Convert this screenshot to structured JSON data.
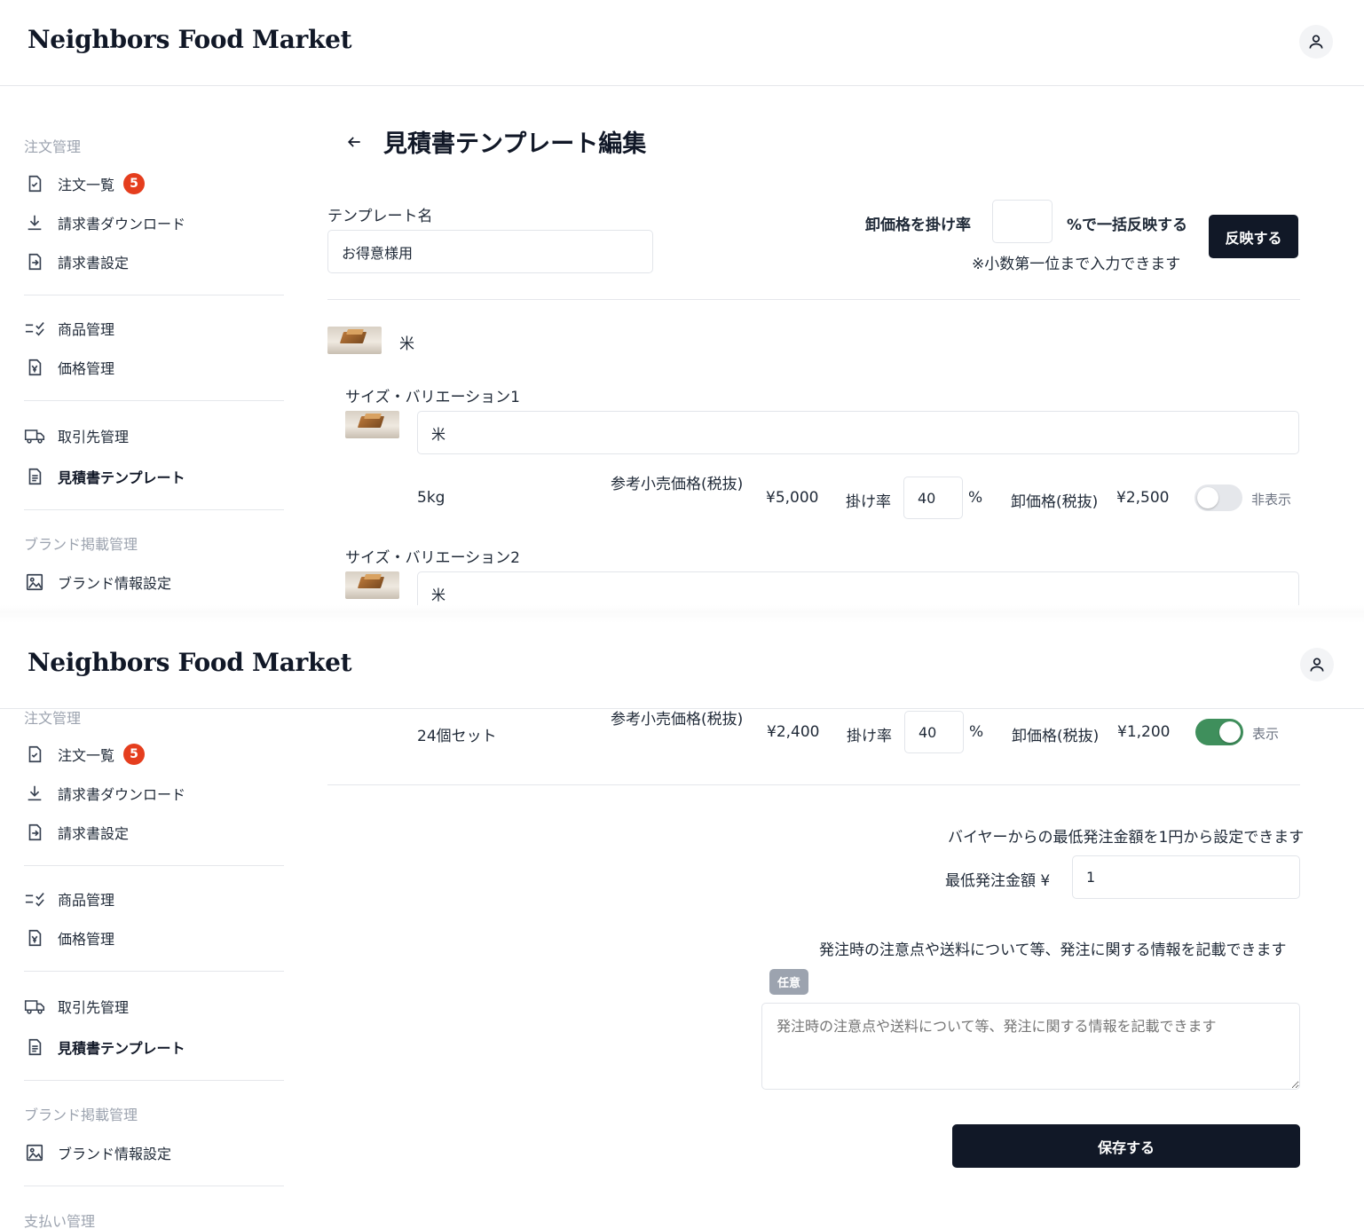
{
  "app": {
    "brand": "Neighbors Food Market"
  },
  "sidebar": {
    "sections": [
      "注文管理",
      "ブランド掲載管理",
      "支払い管理"
    ],
    "items": [
      {
        "label": "注文一覧",
        "icon": "order-list-icon",
        "badge": "5"
      },
      {
        "label": "請求書ダウンロード",
        "icon": "download-icon"
      },
      {
        "label": "請求書設定",
        "icon": "invoice-settings-icon"
      },
      {
        "label": "商品管理",
        "icon": "product-list-icon"
      },
      {
        "label": "価格管理",
        "icon": "price-icon"
      },
      {
        "label": "取引先管理",
        "icon": "truck-icon"
      },
      {
        "label": "見積書テンプレート",
        "icon": "document-icon"
      },
      {
        "label": "ブランド情報設定",
        "icon": "image-icon"
      }
    ]
  },
  "page": {
    "title": "見積書テンプレート編集"
  },
  "form": {
    "template_name_label": "テンプレート名",
    "template_name_value": "お得意様用",
    "bulk_rate_label_pre": "卸価格を掛け率",
    "bulk_rate_value": "",
    "bulk_rate_label_post": "%で一括反映する",
    "bulk_rate_note": "※小数第一位まで入力できます",
    "apply_button": "反映する"
  },
  "product": {
    "name": "米",
    "variations": [
      {
        "label": "サイズ・バリエーション1",
        "name": "米",
        "size": "5kg",
        "retail_label": "参考小売価格(税抜)",
        "retail_price": "¥5,000",
        "rate_label": "掛け率",
        "rate": "40",
        "percent": "%",
        "wholesale_label": "卸価格(税抜)",
        "wholesale_price": "¥2,500",
        "visible": false,
        "visibility_label": "非表示"
      },
      {
        "label": "サイズ・バリエーション2",
        "name": "米"
      },
      {
        "size": "24個セット",
        "retail_label": "参考小売価格(税抜)",
        "retail_price": "¥2,400",
        "rate_label": "掛け率",
        "rate": "40",
        "percent": "%",
        "wholesale_label": "卸価格(税抜)",
        "wholesale_price": "¥1,200",
        "visible": true,
        "visibility_label": "表示"
      }
    ]
  },
  "minimum_order": {
    "help": "バイヤーからの最低発注金額を1円から設定できます",
    "label": "最低発注金額 ¥",
    "value": "1"
  },
  "order_notes": {
    "help": "発注時の注意点や送料について等、発注に関する情報を記載できます",
    "optional_tag": "任意",
    "placeholder": "発注時の注意点や送料について等、発注に関する情報を記載できます"
  },
  "save_button": "保存する",
  "colors": {
    "primary_dark": "#111827",
    "badge_red": "#e53e1e",
    "toggle_on": "#3f8f5c"
  }
}
